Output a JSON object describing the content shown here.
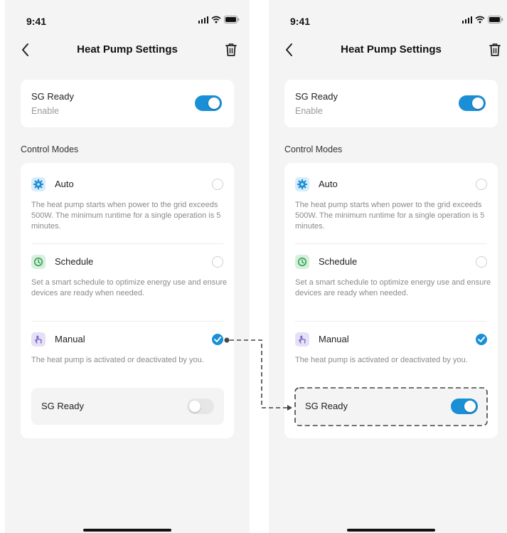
{
  "screens": [
    {
      "status": {
        "time": "9:41"
      },
      "header": {
        "title": "Heat Pump Settings"
      },
      "sg_ready_card": {
        "title": "SG Ready",
        "subtitle": "Enable",
        "toggle_on": true
      },
      "section_label": "Control Modes",
      "modes": [
        {
          "name": "Auto",
          "icon": "gear-icon",
          "description": "The heat pump starts when power to the grid exceeds 500W. The minimum runtime for a single operation is 5 minutes.",
          "selected": false
        },
        {
          "name": "Schedule",
          "icon": "clock-icon",
          "description": "Set a smart schedule to optimize energy use and ensure devices are ready when needed.",
          "selected": false
        },
        {
          "name": "Manual",
          "icon": "hand-tap-icon",
          "description": "The heat pump is activated or deactivated by you.",
          "selected": true
        }
      ],
      "manual_sub": {
        "label": "SG Ready",
        "toggle_on": false
      }
    },
    {
      "status": {
        "time": "9:41"
      },
      "header": {
        "title": "Heat Pump Settings"
      },
      "sg_ready_card": {
        "title": "SG Ready",
        "subtitle": "Enable",
        "toggle_on": true
      },
      "section_label": "Control Modes",
      "modes": [
        {
          "name": "Auto",
          "icon": "gear-icon",
          "description": "The heat pump starts when power to the grid exceeds 500W. The minimum runtime for a single operation is 5 minutes.",
          "selected": false
        },
        {
          "name": "Schedule",
          "icon": "clock-icon",
          "description": "Set a smart schedule to optimize energy use and ensure devices are ready when needed.",
          "selected": false
        },
        {
          "name": "Manual",
          "icon": "hand-tap-icon",
          "description": "The heat pump is activated or deactivated by you.",
          "selected": true
        }
      ],
      "manual_sub": {
        "label": "SG Ready",
        "toggle_on": true
      }
    }
  ],
  "colors": {
    "accent": "#1a8fd6",
    "screen_bg": "#f4f4f4",
    "card_bg": "#ffffff",
    "auto_icon_bg": "#d8ecfa",
    "schedule_icon_bg": "#d6f0dc",
    "manual_icon_bg": "#e6e0f7",
    "annotation": "#444444"
  }
}
